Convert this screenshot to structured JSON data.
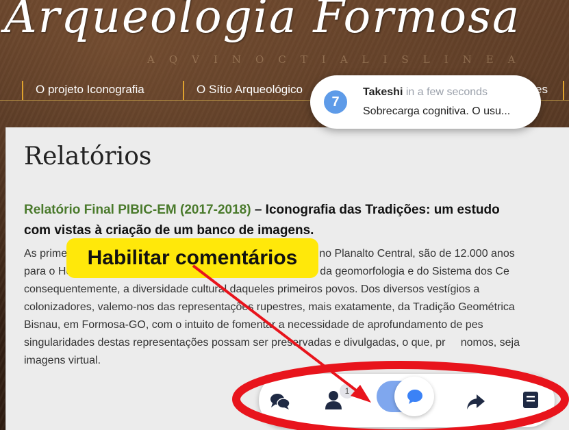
{
  "site": {
    "title": "Arqueologia Formosa",
    "map_text": "AQVINOCTIALISLINEA"
  },
  "nav": {
    "items": [
      {
        "label": "O projeto Iconografia"
      },
      {
        "label": "O Sítio Arqueológico"
      },
      {
        "label": "es"
      }
    ]
  },
  "content": {
    "page_title": "Relatórios",
    "report_link": "Relatório Final PIBIC-EM (2017-2018)",
    "report_title_line1": " – Iconografia das Tradições: um estudo",
    "report_title_line2": "com vistas à criação de um banco de imagens.",
    "paragraph_lines": [
      "As prime                                                                          istro, no Planalto Central, são de 12.000 anos",
      "para o Holoceno, onde, dadas as características específicas da geomorfologia e do Sistema dos Ce",
      "consequentemente, a diversidade cultural daqueles primeiros povos. Dos diversos vestígios a",
      "colonizadores, valemo-nos das representações rupestres, mais exatamente, da Tradição Geométrica",
      "Bisnau, em Formosa-GO, com o intuito de fomentar a necessidade de aprofundamento de pes",
      "singularidades destas representações possam ser preservadas e divulgadas, o que, pr     nomos, seja",
      "imagens virtual."
    ]
  },
  "notification": {
    "badge": "7",
    "user": "Takeshi",
    "time": " in a few seconds",
    "message": "Sobrecarga cognitiva. O usu..."
  },
  "annotation": {
    "callout": "Habilitar comentários",
    "highlight_color": "#e8141c",
    "callout_color": "#ffe80a"
  },
  "toolbar": {
    "icons": [
      "comments-icon",
      "user-icon",
      "comment-toggle",
      "share-icon",
      "notes-icon"
    ],
    "user_count": "1",
    "toggle_on": true,
    "accent": "#5e9be8"
  }
}
